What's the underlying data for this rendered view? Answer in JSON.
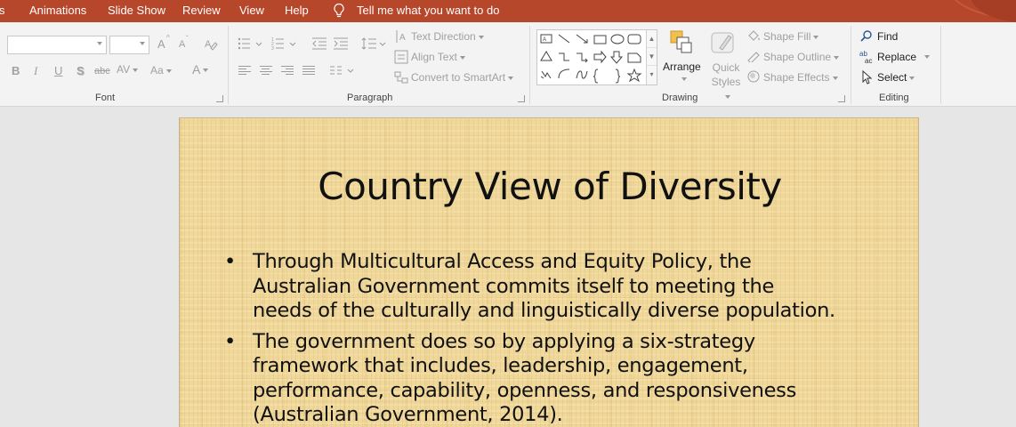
{
  "tabs": [
    {
      "label": "s"
    },
    {
      "label": "Animations"
    },
    {
      "label": "Slide Show"
    },
    {
      "label": "Review"
    },
    {
      "label": "View"
    },
    {
      "label": "Help"
    }
  ],
  "tell_me": "Tell me what you want to do",
  "ribbon": {
    "font": {
      "label": "Font",
      "font_name": "",
      "font_size": "",
      "grow": "A",
      "shrink": "A",
      "bold": "B",
      "italic": "I",
      "underline": "U",
      "shadow": "S",
      "strike": "abc",
      "spacing": "AV",
      "case": "Aa",
      "color": "A"
    },
    "paragraph": {
      "label": "Paragraph",
      "text_direction": "Text Direction",
      "align_text": "Align Text",
      "convert_smartart": "Convert to SmartArt"
    },
    "drawing": {
      "label": "Drawing",
      "arrange": "Arrange",
      "quick_styles": "Quick Styles",
      "shape_fill": "Shape Fill",
      "shape_outline": "Shape Outline",
      "shape_effects": "Shape Effects"
    },
    "editing": {
      "label": "Editing",
      "find": "Find",
      "replace": "Replace",
      "select": "Select"
    }
  },
  "slide": {
    "title": "Country View of Diversity",
    "bullets": [
      {
        "lines": [
          "Through Multicultural Access and Equity Policy, the",
          "Australian Government commits itself to meeting the",
          "needs of the culturally and linguistically diverse population."
        ]
      },
      {
        "lines": [
          "The government does so by applying a six-strategy",
          "framework that includes, leadership, engagement,",
          "performance, capability, openness, and responsiveness",
          "(Australian Government, 2014)."
        ]
      }
    ]
  },
  "colors": {
    "accent": "#b7472a",
    "ribbon": "#f3f3f3",
    "workspace": "#e6e6e6",
    "slide_bg": "#f0d89a"
  }
}
